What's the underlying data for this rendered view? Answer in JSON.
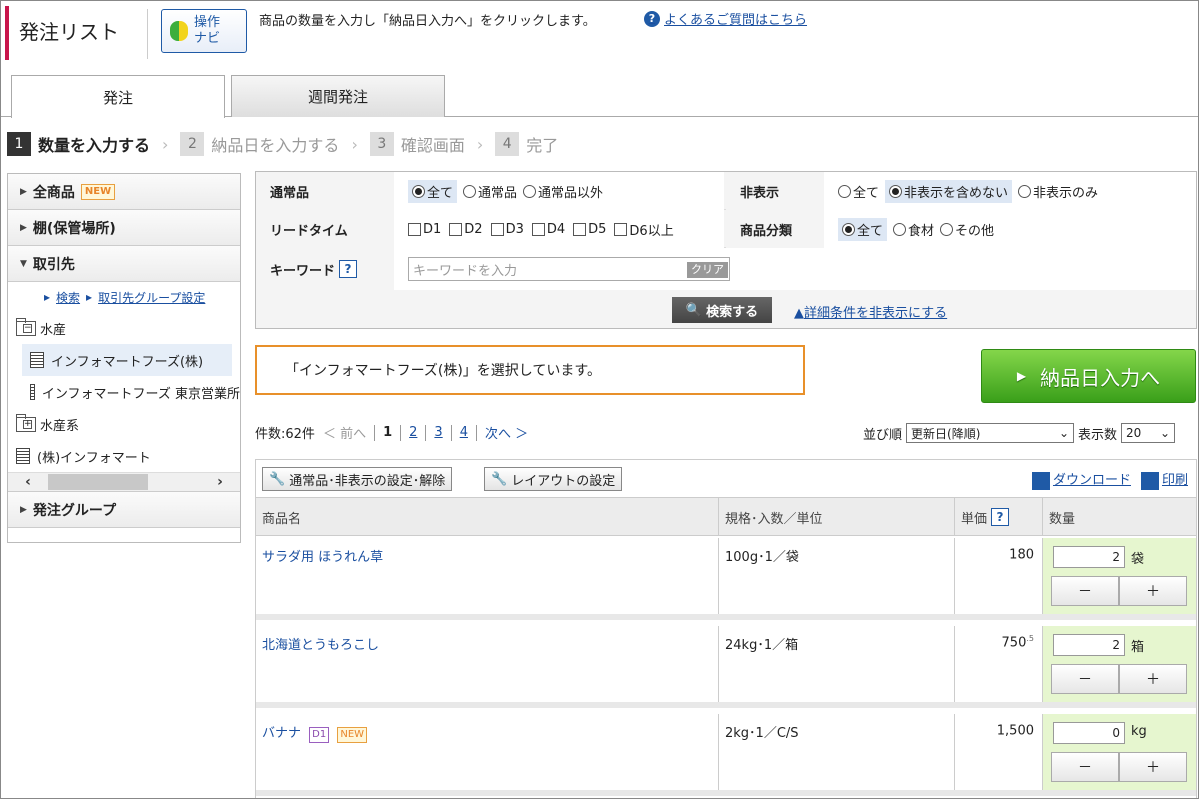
{
  "header": {
    "title": "発注リスト",
    "navi_label_1": "操作",
    "navi_label_2": "ナビ",
    "instruction": "商品の数量を入力し「納品日入力へ」をクリックします。",
    "faq_link": "よくあるご質問はこちら"
  },
  "tabs": [
    {
      "label": "発注",
      "active": true
    },
    {
      "label": "週間発注",
      "active": false
    }
  ],
  "steps": [
    {
      "num": "1",
      "label": "数量を入力する",
      "active": true
    },
    {
      "num": "2",
      "label": "納品日を入力する",
      "active": false
    },
    {
      "num": "3",
      "label": "確認画面",
      "active": false
    },
    {
      "num": "4",
      "label": "完了",
      "active": false
    }
  ],
  "sidebar": {
    "all_products": "全商品",
    "new_badge": "NEW",
    "shelf": "棚(保管場所)",
    "suppliers": "取引先",
    "link_search": "検索",
    "link_group": "取引先グループ設定",
    "tree": [
      {
        "label": "水産",
        "type": "folder-open"
      },
      {
        "label": "インフォマートフーズ(株)",
        "type": "building",
        "selected": true
      },
      {
        "label": "インフォマートフーズ 東京営業所",
        "type": "building"
      },
      {
        "label": "水産系",
        "type": "folder-closed"
      },
      {
        "label": "(株)インフォマート",
        "type": "building"
      }
    ],
    "order_group": "発注グループ"
  },
  "filter": {
    "normal_label": "通常品",
    "normal_options": [
      "全て",
      "通常品",
      "通常品以外"
    ],
    "hidden_label": "非表示",
    "hidden_options": [
      "全て",
      "非表示を含めない",
      "非表示のみ"
    ],
    "leadtime_label": "リードタイム",
    "leadtime_options": [
      "D1",
      "D2",
      "D3",
      "D4",
      "D5",
      "D6以上"
    ],
    "category_label": "商品分類",
    "category_options": [
      "全て",
      "食材",
      "その他"
    ],
    "keyword_label": "キーワード",
    "keyword_placeholder": "キーワードを入力",
    "clear_label": "クリア",
    "search_label": "検索する",
    "hide_details_label": "詳細条件を非表示にする"
  },
  "notice": "「インフォマートフーズ(株)」を選択しています。",
  "delivery_button": "納品日入力へ",
  "pager": {
    "count": "件数:62件",
    "prev": "＜ 前へ",
    "pages": [
      "1",
      "2",
      "3",
      "4"
    ],
    "next": "次へ ＞",
    "sort_label": "並び順",
    "sort_value": "更新日(降順)",
    "per_page_label": "表示数",
    "per_page_value": "20"
  },
  "toolbar": {
    "normal_hidden_setting": "通常品･非表示の設定･解除",
    "layout_setting": "レイアウトの設定",
    "download": "ダウンロード",
    "print": "印刷"
  },
  "columns": {
    "name": "商品名",
    "spec": "規格･入数／単位",
    "price": "単価",
    "qty": "数量"
  },
  "rows": [
    {
      "name": "サラダ用 ほうれん草",
      "spec": "100g･1／袋",
      "price": "180",
      "price_frac": "",
      "qty": "2",
      "unit": "袋",
      "tags": []
    },
    {
      "name": "北海道とうもろこし",
      "spec": "24kg･1／箱",
      "price": "750",
      "price_frac": ".5",
      "qty": "2",
      "unit": "箱",
      "tags": []
    },
    {
      "name": "バナナ",
      "spec": "2kg･1／C/S",
      "price": "1,500",
      "price_frac": "",
      "qty": "0",
      "unit": "kg",
      "tags": [
        "D1",
        "NEW"
      ]
    }
  ],
  "stepper": {
    "minus": "－",
    "plus": "＋"
  }
}
